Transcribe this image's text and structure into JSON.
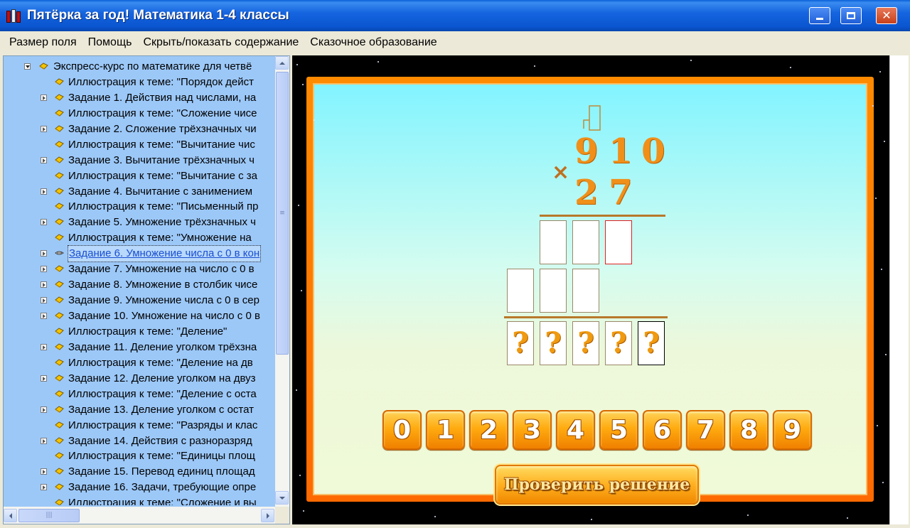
{
  "window": {
    "title": "Пятёрка за год! Математика 1-4 классы"
  },
  "menu": {
    "items": [
      {
        "label": "Размер поля"
      },
      {
        "label": "Помощь"
      },
      {
        "label": "Скрыть/показать содержание"
      },
      {
        "label": "Сказочное образование"
      }
    ]
  },
  "tree": {
    "root": "Экспресс-курс по математике для четвё",
    "items": [
      {
        "label": "Иллюстрация к теме: \"Порядок дейст",
        "expandable": false,
        "selected": false
      },
      {
        "label": "Задание 1. Действия над числами, на",
        "expandable": true,
        "selected": false
      },
      {
        "label": "Иллюстрация к теме: \"Сложение чисе",
        "expandable": false,
        "selected": false
      },
      {
        "label": "Задание 2. Сложение трёхзначных чи",
        "expandable": true,
        "selected": false
      },
      {
        "label": "Иллюстрация к теме: \"Вычитание чис",
        "expandable": false,
        "selected": false
      },
      {
        "label": "Задание 3. Вычитание трёхзначных ч",
        "expandable": true,
        "selected": false
      },
      {
        "label": "Иллюстрация к теме: \"Вычитание с за",
        "expandable": false,
        "selected": false
      },
      {
        "label": "Задание 4. Вычитание с занимением",
        "expandable": true,
        "selected": false
      },
      {
        "label": "Иллюстрация к теме: \"Письменный пр",
        "expandable": false,
        "selected": false
      },
      {
        "label": "Задание 5. Умножение трёхзначных ч",
        "expandable": true,
        "selected": false
      },
      {
        "label": "Иллюстрация к теме: \"Умножение на",
        "expandable": false,
        "selected": false
      },
      {
        "label": "Задание 6. Умножение числа с 0 в кон",
        "expandable": true,
        "selected": true
      },
      {
        "label": "Задание 7. Умножение на число с 0 в",
        "expandable": true,
        "selected": false
      },
      {
        "label": "Задание 8. Умножение в столбик чисе",
        "expandable": true,
        "selected": false
      },
      {
        "label": "Задание 9. Умножение числа с 0 в сер",
        "expandable": true,
        "selected": false
      },
      {
        "label": "Задание 10. Умножение на число с 0 в",
        "expandable": true,
        "selected": false
      },
      {
        "label": "Иллюстрация к теме: \"Деление\"",
        "expandable": false,
        "selected": false
      },
      {
        "label": "Задание 11. Деление уголком трёхзна",
        "expandable": true,
        "selected": false
      },
      {
        "label": "Иллюстрация к теме: \"Деление на дв",
        "expandable": false,
        "selected": false
      },
      {
        "label": "Задание 12. Деление уголком на двуз",
        "expandable": true,
        "selected": false
      },
      {
        "label": "Иллюстрация к теме: \"Деление с оста",
        "expandable": false,
        "selected": false
      },
      {
        "label": "Задание 13. Деление уголком с остат",
        "expandable": true,
        "selected": false
      },
      {
        "label": "Иллюстрация к теме: \"Разряды и клас",
        "expandable": false,
        "selected": false
      },
      {
        "label": "Задание 14. Действия с разноразряд",
        "expandable": true,
        "selected": false
      },
      {
        "label": "Иллюстрация к теме: \"Единицы площ",
        "expandable": false,
        "selected": false
      },
      {
        "label": "Задание 15. Перевод единиц площад",
        "expandable": true,
        "selected": false
      },
      {
        "label": "Задание 16. Задачи, требующие опре",
        "expandable": true,
        "selected": false
      },
      {
        "label": "Иллюстрация к теме: \"Сложение и вы",
        "expandable": false,
        "selected": false
      }
    ]
  },
  "exercise": {
    "multiplicand": [
      "9",
      "1",
      "0"
    ],
    "multiplier": [
      "2",
      "7"
    ],
    "operator": "×",
    "answer_slots": [
      "?",
      "?",
      "?",
      "?",
      "?"
    ],
    "keypad": [
      "0",
      "1",
      "2",
      "3",
      "4",
      "5",
      "6",
      "7",
      "8",
      "9"
    ],
    "check_button": "Проверить решение"
  },
  "colors": {
    "title_bar": "#0a55d0",
    "tree_bg": "#9cc8f8",
    "frame_orange": "#ff7a00",
    "digit_orange": "#f0901a"
  }
}
